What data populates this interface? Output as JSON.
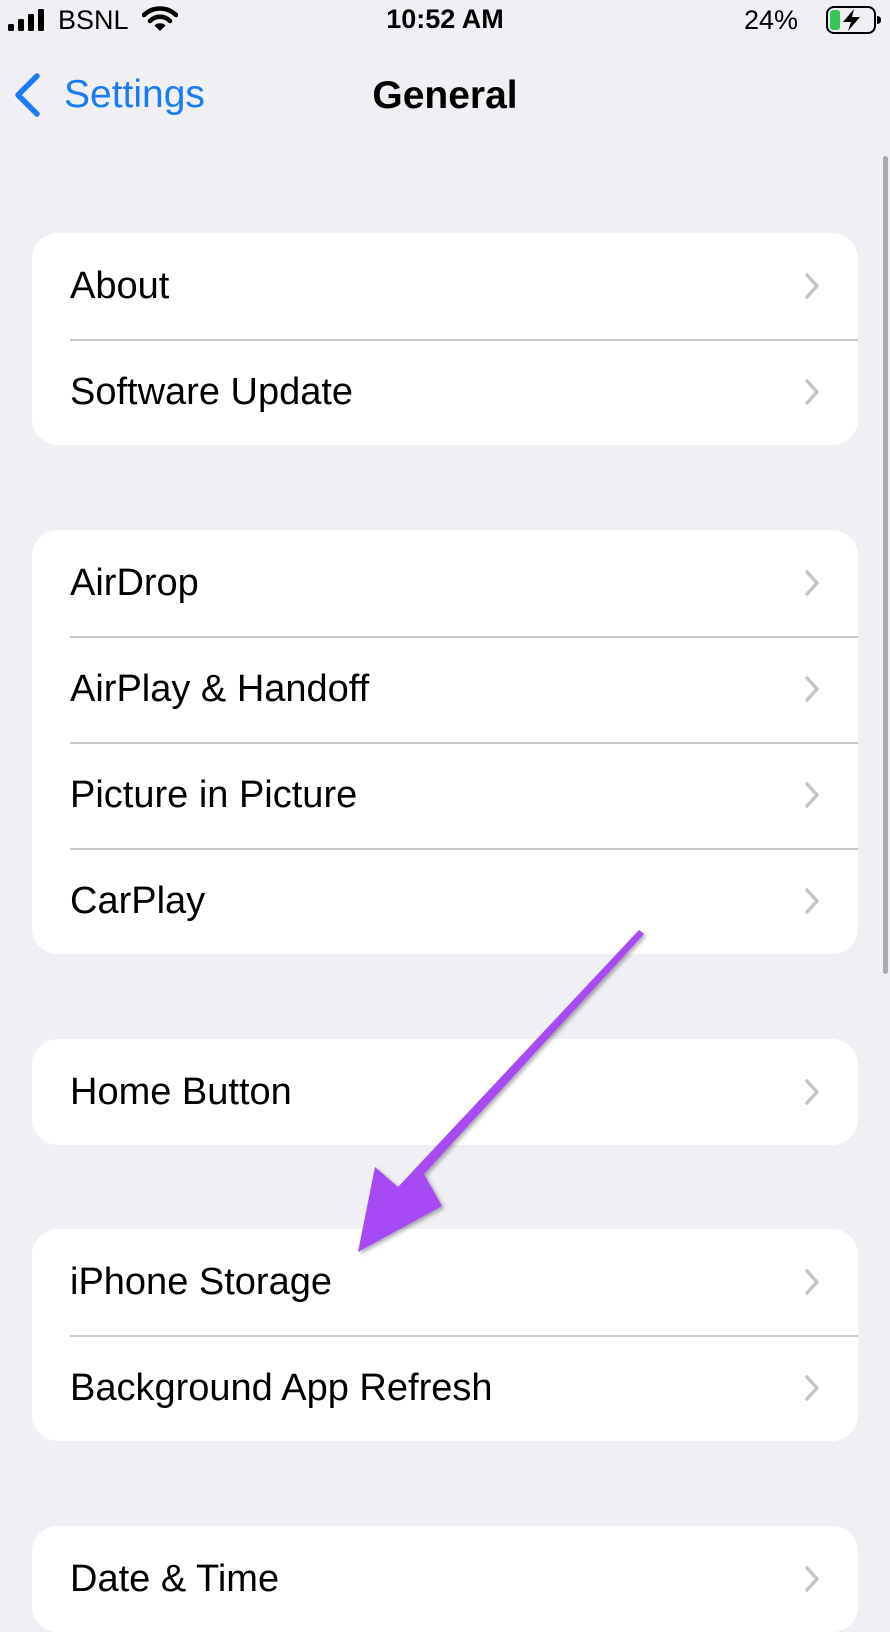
{
  "status_bar": {
    "carrier": "BSNL",
    "time": "10:52 AM",
    "battery_percent": "24%",
    "battery_level": 0.24,
    "battery_charging": true,
    "icons": [
      "cellular-signal-icon",
      "wifi-icon",
      "battery-charging-icon"
    ]
  },
  "nav": {
    "back_label": "Settings",
    "title": "General"
  },
  "groups": [
    {
      "rows": [
        {
          "label": "About"
        },
        {
          "label": "Software Update"
        }
      ]
    },
    {
      "rows": [
        {
          "label": "AirDrop"
        },
        {
          "label": "AirPlay & Handoff"
        },
        {
          "label": "Picture in Picture"
        },
        {
          "label": "CarPlay"
        }
      ]
    },
    {
      "rows": [
        {
          "label": "Home Button"
        }
      ]
    },
    {
      "rows": [
        {
          "label": "iPhone Storage"
        },
        {
          "label": "Background App Refresh"
        }
      ]
    },
    {
      "rows": [
        {
          "label": "Date & Time"
        }
      ]
    }
  ],
  "colors": {
    "background": "#efeff4",
    "accent": "#1a7cf5",
    "annotation_arrow": "#a64bf4",
    "battery_fill": "#34c759"
  }
}
